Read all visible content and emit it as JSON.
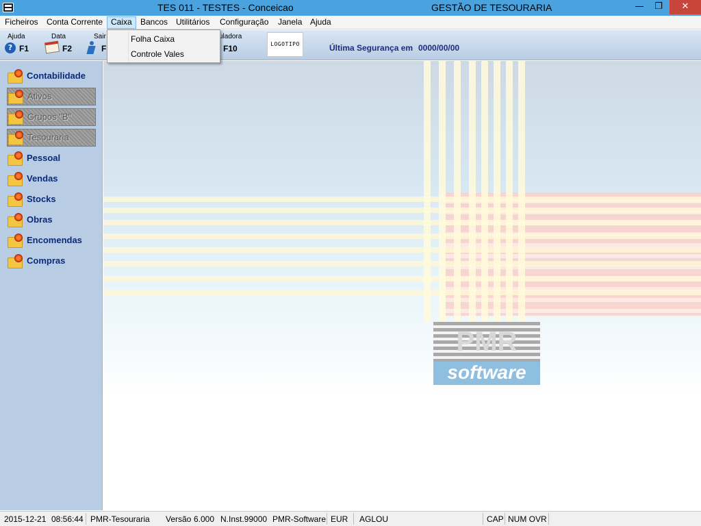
{
  "titlebar": {
    "title": "TES 011 - TESTES - Conceicao",
    "app_title": "GESTÃO DE TESOURARIA",
    "minimize": "—",
    "maximize": "❐",
    "close": "✕"
  },
  "menu": {
    "items": [
      "Ficheiros",
      "Conta Corrente",
      "Caixa",
      "Bancos",
      "Utilitários",
      "Configuração",
      "Janela",
      "Ajuda"
    ],
    "active": "Caixa"
  },
  "dropdown": {
    "items": [
      "Folha Caixa",
      "Controle Vales"
    ]
  },
  "toolbar": {
    "help_label": "Ajuda",
    "help_key": "F1",
    "date_label": "Data",
    "date_key": "F2",
    "exit_label": "Sair",
    "exit_key": "F",
    "calc_label": "uladora",
    "calc_key": "F10",
    "logo_text": "LOGOTIPO",
    "security_label": "Última Segurança em",
    "security_value": "0000/00/00"
  },
  "sidebar": {
    "items": [
      {
        "label": "Contabilidade",
        "disabled": false
      },
      {
        "label": "Ativos",
        "disabled": true
      },
      {
        "label": "Grupos \"B\"",
        "disabled": true
      },
      {
        "label": "Tesouraria",
        "disabled": true
      },
      {
        "label": "Pessoal",
        "disabled": false
      },
      {
        "label": "Vendas",
        "disabled": false
      },
      {
        "label": "Stocks",
        "disabled": false
      },
      {
        "label": "Obras",
        "disabled": false
      },
      {
        "label": "Encomendas",
        "disabled": false
      },
      {
        "label": "Compras",
        "disabled": false
      }
    ]
  },
  "logo": {
    "brand": "PMR",
    "tagline": "software"
  },
  "status": {
    "date": "2015-12-21",
    "time": "08:56:44",
    "module": "PMR-Tesouraria",
    "version_label": "Versão",
    "version": "6.000",
    "installation": "N.Inst.99000",
    "vendor": "PMR-Software",
    "currency": "EUR",
    "user": "AGLOU",
    "cap": "CAP",
    "num_ovr": "NUM OVR"
  }
}
